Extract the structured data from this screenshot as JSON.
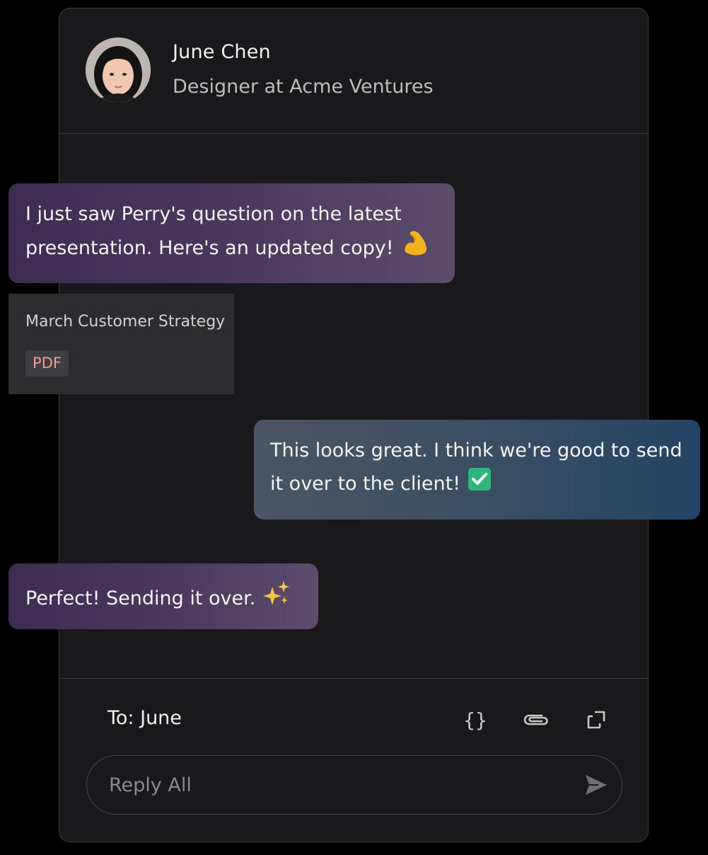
{
  "contact": {
    "name": "June Chen",
    "role": "Designer at Acme Ventures"
  },
  "messages": [
    {
      "direction": "incoming",
      "text": "I just saw Perry's question on the latest presentation. Here's an updated copy!",
      "emoji": "flexed-biceps"
    },
    {
      "direction": "outgoing",
      "text": "This looks great. I think we're good to send it over to the client!",
      "emoji": "check-mark-button"
    },
    {
      "direction": "incoming",
      "text": "Perfect! Sending it over.",
      "emoji": "sparkles"
    }
  ],
  "attachment": {
    "title": "March Customer Strategy",
    "badge": "PDF"
  },
  "composer": {
    "to_label": "To: June",
    "placeholder": "Reply All",
    "icons": [
      "braces-icon",
      "paperclip-icon",
      "expand-icon",
      "send-icon"
    ]
  },
  "colors": {
    "background": "#000000",
    "card": "#19191b",
    "incoming_bubble": "#4b3a5e",
    "outgoing_bubble": "#2f4a64",
    "pdf_text": "#ee9d92"
  }
}
